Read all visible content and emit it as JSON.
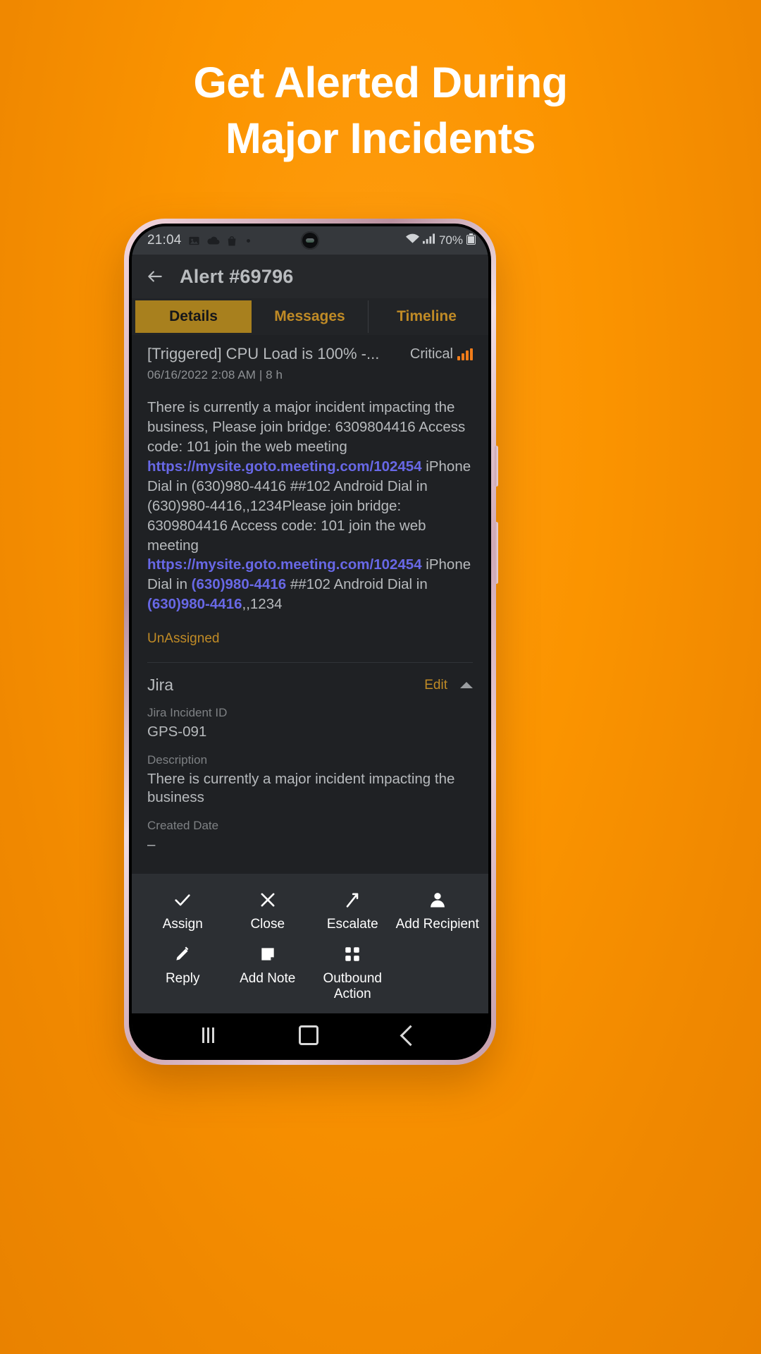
{
  "promo": {
    "headline_line1": "Get Alerted During",
    "headline_line2": "Major Incidents",
    "background_color": "#fb9400",
    "headline_color": "#ffffff"
  },
  "statusbar": {
    "time": "21:04",
    "battery_percent": "70%",
    "icons": [
      "image-icon",
      "cloud-icon",
      "shopping-bag-icon",
      "dot-icon",
      "wifi-icon",
      "cellular-signal-icon",
      "battery-icon"
    ]
  },
  "appbar": {
    "back_icon": "arrow-left-icon",
    "title": "Alert #69796"
  },
  "tabs": [
    {
      "label": "Details",
      "active": true
    },
    {
      "label": "Messages",
      "active": false
    },
    {
      "label": "Timeline",
      "active": false
    }
  ],
  "alert": {
    "title": "[Triggered] CPU Load is 100% -...",
    "severity_label": "Critical",
    "severity_icon": "signal-bars-icon",
    "timestamp": "06/16/2022 2:08 AM",
    "duration": "8 h",
    "meta_separator": "|",
    "body_segments": [
      {
        "text": "There is currently a major incident impacting the business,  Please join bridge: 6309804416 Access code: 101 join the web meeting ",
        "link": false
      },
      {
        "text": "https://mysite.goto.meeting.com/102454",
        "link": true
      },
      {
        "text": " iPhone Dial in (630)980-4416 ##102 Android Dial in (630)980-4416,,1234Please join bridge: 6309804416 Access code: 101 join the web meeting ",
        "link": false
      },
      {
        "text": "https://mysite.goto.meeting.com/102454",
        "link": true
      },
      {
        "text": " iPhone Dial in ",
        "link": false
      },
      {
        "text": "(630)980-4416",
        "link": true
      },
      {
        "text": " ##102 Android Dial in ",
        "link": false
      },
      {
        "text": "(630)980-4416",
        "link": true
      },
      {
        "text": ",,1234",
        "link": false
      }
    ],
    "assignment": "UnAssigned",
    "link_color": "#6868e6",
    "accent_color": "#c08b26"
  },
  "jira_section": {
    "title": "Jira",
    "edit_label": "Edit",
    "collapse_icon": "chevron-up-icon",
    "fields": [
      {
        "label": "Jira Incident ID",
        "value": "GPS-091"
      },
      {
        "label": "Description",
        "value": "There is currently a major incident impacting the business"
      },
      {
        "label": "Created Date",
        "value": "–"
      }
    ]
  },
  "actions": {
    "row1": [
      {
        "label": "Assign",
        "icon": "check-icon"
      },
      {
        "label": "Close",
        "icon": "close-x-icon"
      },
      {
        "label": "Escalate",
        "icon": "escalate-arrow-icon"
      },
      {
        "label": "Add Recipient",
        "icon": "person-icon"
      }
    ],
    "row2": [
      {
        "label": "Reply",
        "icon": "pencil-icon"
      },
      {
        "label": "Add Note",
        "icon": "note-icon"
      },
      {
        "label": "Outbound Action",
        "icon": "grid-dots-icon"
      }
    ]
  },
  "navbar": {
    "recents": "recents-icon",
    "home": "home-icon",
    "back": "back-icon"
  }
}
